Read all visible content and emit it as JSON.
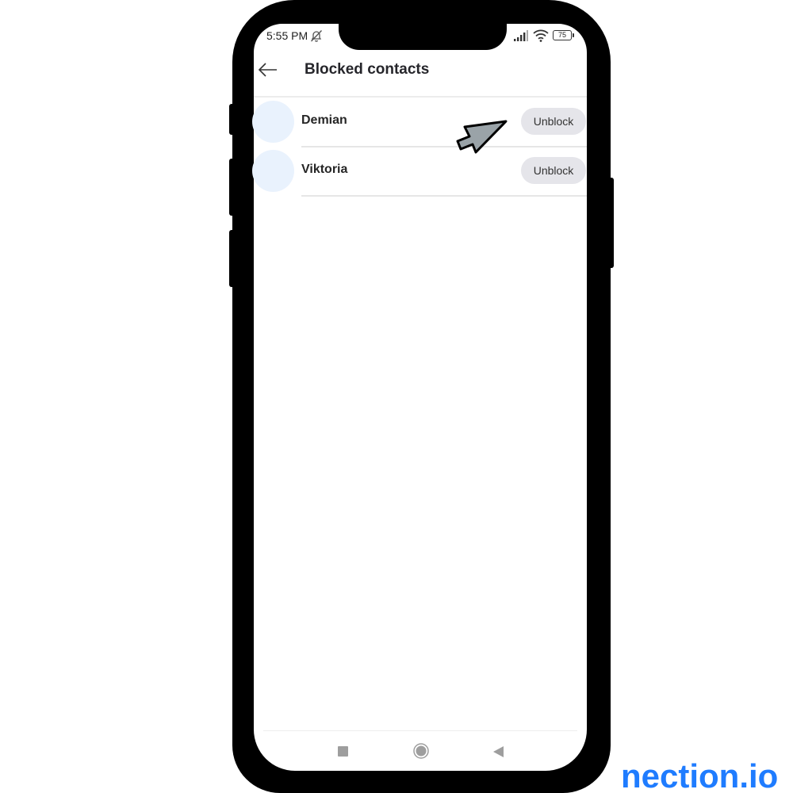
{
  "status_bar": {
    "time": "5:55 PM",
    "mute_icon": "bell-off-icon",
    "signal_icon": "cellular-signal-icon",
    "wifi_icon": "wifi-icon",
    "battery_level": "75"
  },
  "header": {
    "back_icon": "arrow-left-icon",
    "title": "Blocked contacts"
  },
  "contacts": [
    {
      "name": "Demian",
      "action_label": "Unblock"
    },
    {
      "name": "Viktoria",
      "action_label": "Unblock"
    }
  ],
  "navigation_bar": {
    "recents_icon": "square-icon",
    "home_icon": "circle-home-icon",
    "back_icon": "triangle-back-icon"
  },
  "watermark": "nection.io",
  "colors": {
    "avatar_bg": "#e9f2fd",
    "button_bg": "#e5e5ea",
    "watermark": "#1f7cff",
    "cursor_fill": "#9aa3a8"
  }
}
